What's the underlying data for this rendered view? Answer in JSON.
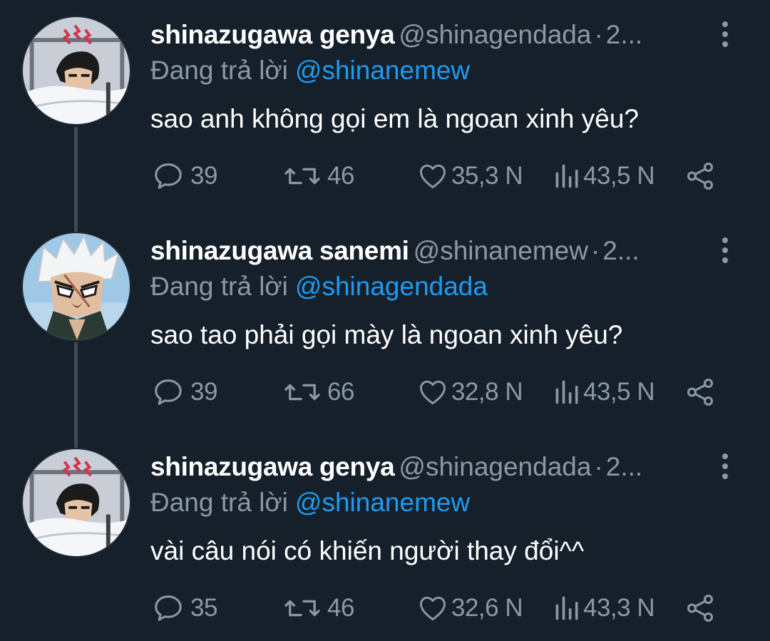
{
  "colors": {
    "background": "#15202b",
    "secondary_text": "#8b98a5",
    "link": "#1d9bf0",
    "thread_line": "#3d4954"
  },
  "tweets": [
    {
      "avatar_icon": "genya-avatar",
      "display_name": "shinazugawa genya",
      "handle": "@shinagendada",
      "separator": "·",
      "time": "2...",
      "reply_prefix": "Đang trả lời",
      "reply_to": "@shinanemew",
      "text": "sao anh không gọi em là ngoan xinh yêu?",
      "replies": "39",
      "retweets": "46",
      "likes": "35,3 N",
      "views": "43,5 N"
    },
    {
      "avatar_icon": "sanemi-avatar",
      "display_name": "shinazugawa sanemi",
      "handle": "@shinanemew",
      "separator": "·",
      "time": "2...",
      "reply_prefix": "Đang trả lời",
      "reply_to": "@shinagendada",
      "text": "sao tao phải gọi mày là ngoan xinh yêu?",
      "replies": "39",
      "retweets": "66",
      "likes": "32,8 N",
      "views": "43,5 N"
    },
    {
      "avatar_icon": "genya-avatar",
      "display_name": "shinazugawa genya",
      "handle": "@shinagendada",
      "separator": "·",
      "time": "2...",
      "reply_prefix": "Đang trả lời",
      "reply_to": "@shinanemew",
      "text": "vài câu nói có khiến người thay đổi^^",
      "replies": "35",
      "retweets": "46",
      "likes": "32,6 N",
      "views": "43,3 N"
    }
  ]
}
